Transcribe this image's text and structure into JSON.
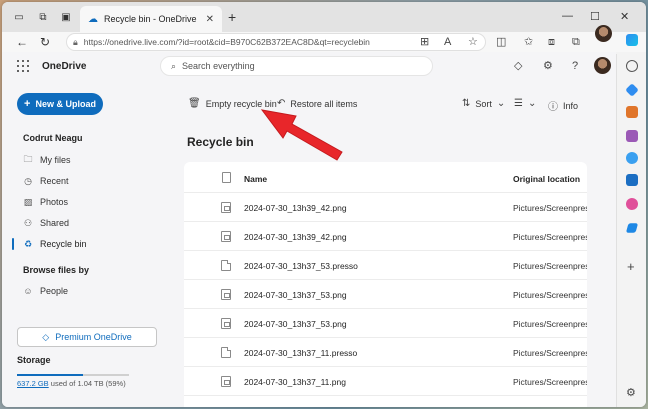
{
  "browser": {
    "tab_title": "Recycle bin - OneDrive",
    "url": "https://onedrive.live.com/?id=root&cid=B970C62B372EAC8D&qt=recyclebin"
  },
  "app": {
    "brand": "OneDrive",
    "search_placeholder": "Search everything"
  },
  "sidebar": {
    "new_button": "New & Upload",
    "user_name": "Codrut Neagu",
    "items": [
      {
        "label": "My files",
        "icon": "folder-icon"
      },
      {
        "label": "Recent",
        "icon": "clock-icon"
      },
      {
        "label": "Photos",
        "icon": "image-icon"
      },
      {
        "label": "Shared",
        "icon": "people-share-icon"
      },
      {
        "label": "Recycle bin",
        "icon": "recycle-bin-icon"
      }
    ],
    "browse_heading": "Browse files by",
    "browse_items": [
      {
        "label": "People",
        "icon": "person-icon"
      }
    ],
    "premium_button": "Premium OneDrive",
    "storage_heading": "Storage",
    "storage_used_link": "637.2 GB",
    "storage_rest": " used of 1.04 TB (59%)",
    "storage_fraction": 0.59
  },
  "commands": {
    "empty_recycle_bin": "Empty recycle bin",
    "restore_all": "Restore all items",
    "sort": "Sort",
    "info": "Info"
  },
  "page_title": "Recycle bin",
  "table": {
    "col_name": "Name",
    "col_location": "Original location",
    "rows": [
      {
        "name": "2024-07-30_13h39_42.png",
        "location": "Pictures/Screenpress",
        "type": "image"
      },
      {
        "name": "2024-07-30_13h39_42.png",
        "location": "Pictures/Screenpress",
        "type": "image"
      },
      {
        "name": "2024-07-30_13h37_53.presso",
        "location": "Pictures/Screenpress",
        "type": "doc"
      },
      {
        "name": "2024-07-30_13h37_53.png",
        "location": "Pictures/Screenpress",
        "type": "image"
      },
      {
        "name": "2024-07-30_13h37_53.png",
        "location": "Pictures/Screenpress",
        "type": "image"
      },
      {
        "name": "2024-07-30_13h37_11.presso",
        "location": "Pictures/Screenpress",
        "type": "doc"
      },
      {
        "name": "2024-07-30_13h37_11.png",
        "location": "Pictures/Screenpress",
        "type": "image"
      }
    ]
  },
  "colors": {
    "accent": "#0f6cbd",
    "annotation_arrow": "#e8262a"
  }
}
